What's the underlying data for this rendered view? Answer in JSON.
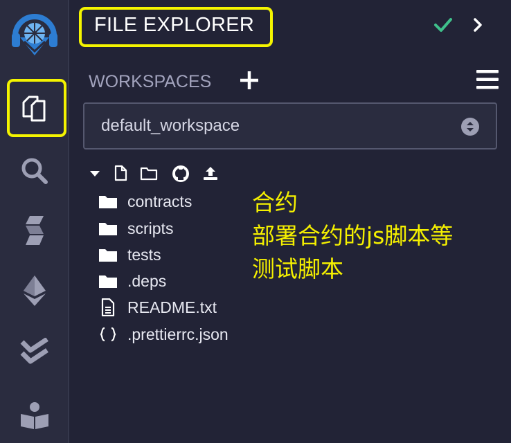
{
  "icon_panel": {
    "items": [
      {
        "name": "remix-logo",
        "icon": "remix-logo-icon"
      },
      {
        "name": "file-explorer",
        "icon": "files-icon",
        "selected": true
      },
      {
        "name": "search",
        "icon": "search-icon"
      },
      {
        "name": "solidity-compiler",
        "icon": "solidity-icon"
      },
      {
        "name": "deploy-run",
        "icon": "ethereum-icon"
      },
      {
        "name": "testing",
        "icon": "double-check-icon"
      },
      {
        "name": "learn",
        "icon": "reader-icon"
      }
    ]
  },
  "header": {
    "title": "FILE EXPLORER",
    "status_icon": "check-icon",
    "status_color": "#3fc08b",
    "collapse_icon": "chevron-right-icon"
  },
  "workspaces": {
    "label": "WORKSPACES",
    "add_icon": "plus-icon",
    "menu_icon": "hamburger-icon",
    "selected": "default_workspace"
  },
  "file_toolbar": {
    "icons": [
      "caret-down-icon",
      "new-file-icon",
      "new-folder-icon",
      "github-icon",
      "upload-icon"
    ]
  },
  "tree": {
    "items": [
      {
        "label": "contracts",
        "type": "folder"
      },
      {
        "label": "scripts",
        "type": "folder"
      },
      {
        "label": "tests",
        "type": "folder"
      },
      {
        "label": ".deps",
        "type": "folder"
      },
      {
        "label": "README.txt",
        "type": "file"
      },
      {
        "label": ".prettierrc.json",
        "type": "json"
      }
    ]
  },
  "annotation": {
    "lines": [
      "合约",
      "部署合约的js脚本等",
      "测试脚本"
    ],
    "color": "#f5f000"
  },
  "highlight_color": "#f4f400"
}
